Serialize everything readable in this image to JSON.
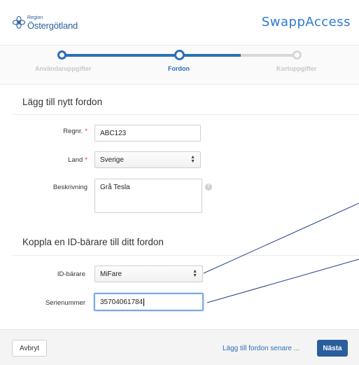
{
  "header": {
    "logo_region": "Region",
    "logo_name": "Östergötland",
    "brand": "SwappAccess"
  },
  "stepper": {
    "steps": [
      {
        "label": "Användaruppgifter",
        "state": "done"
      },
      {
        "label": "Fordon",
        "state": "active"
      },
      {
        "label": "Kortuppgifter",
        "state": "todo"
      }
    ]
  },
  "vehicle_section": {
    "title": "Lägg till nytt fordon",
    "regnr_label": "Regnr.",
    "regnr_value": "ABC123",
    "land_label": "Land",
    "land_value": "Sverige",
    "description_label": "Beskrivning",
    "description_value": "Grå Tesla",
    "required_mark": "*",
    "help_icon": "?"
  },
  "id_section": {
    "title": "Koppla en ID-bärare till ditt fordon",
    "carrier_label": "ID-bärare",
    "carrier_value": "MiFare",
    "serial_label": "Serienummer",
    "serial_value": "35704061784"
  },
  "footer": {
    "cancel_label": "Avbryt",
    "later_label": "Lägg till fordon senare ...",
    "next_label": "Nästa"
  },
  "colors": {
    "accent": "#2b6fb8",
    "primary_button": "#2a5d9c",
    "required": "#d9262c"
  },
  "icons": {
    "select_arrows": "up-down-caret-icon",
    "logo": "region-flower-logo-icon"
  }
}
